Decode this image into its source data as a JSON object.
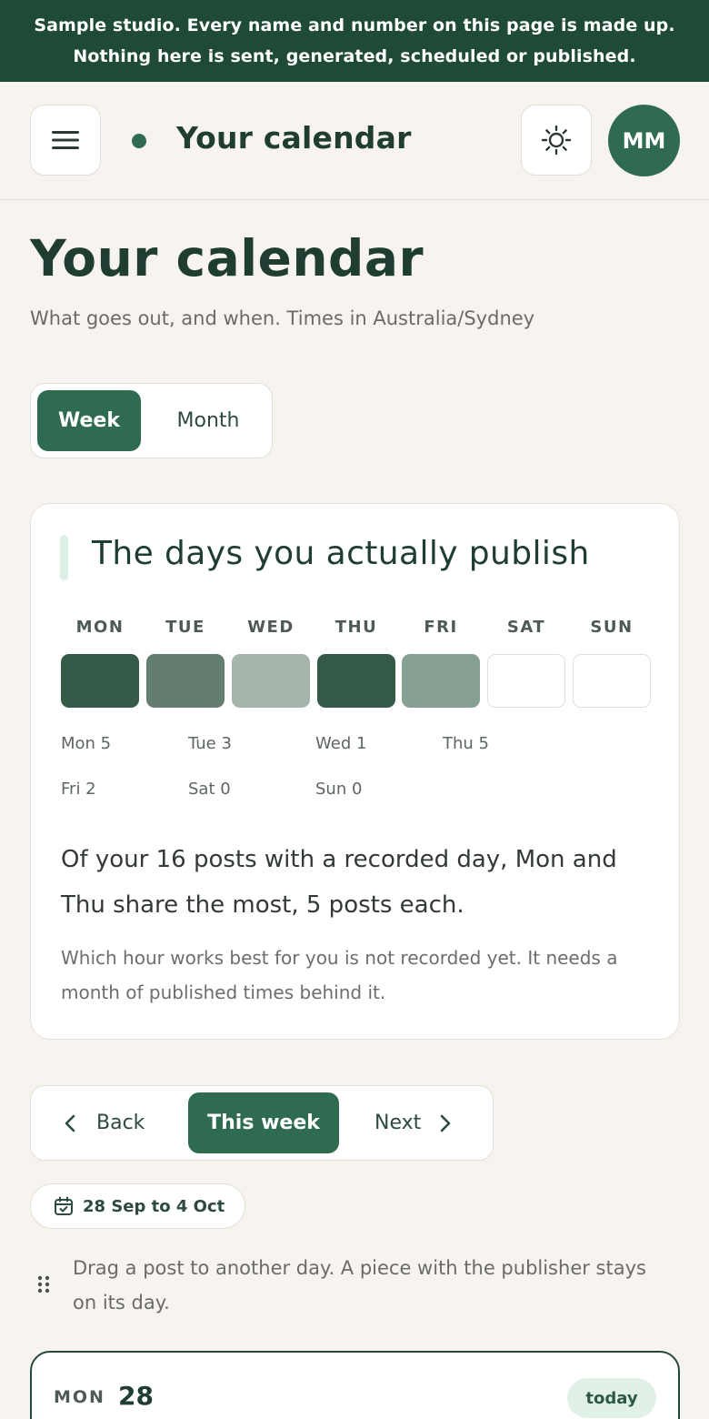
{
  "banner": {
    "line1": "Sample studio. Every name and number on this page is made up.",
    "line2": "Nothing here is sent, generated, scheduled or published."
  },
  "topbar": {
    "title": "Your calendar",
    "avatar_initials": "MM",
    "menu_icon": "hamburger-menu-icon",
    "theme_icon": "sun-icon"
  },
  "page": {
    "title": "Your calendar",
    "subtitle": "What goes out, and when. Times in Australia/Sydney"
  },
  "view_toggle": {
    "week": "Week",
    "month": "Month",
    "selected": "Week"
  },
  "publish_card": {
    "title": "The days you actually publish",
    "days": [
      {
        "label": "MON",
        "count_text": "Mon 5",
        "count": 5
      },
      {
        "label": "TUE",
        "count_text": "Tue 3",
        "count": 3
      },
      {
        "label": "WED",
        "count_text": "Wed 1",
        "count": 1
      },
      {
        "label": "THU",
        "count_text": "Thu 5",
        "count": 5
      },
      {
        "label": "FRI",
        "count_text": "Fri 2",
        "count": 2
      },
      {
        "label": "SAT",
        "count_text": "Sat 0",
        "count": 0
      },
      {
        "label": "SUN",
        "count_text": "Sun 0",
        "count": 0
      }
    ],
    "summary": "Of your 16 posts with a recorded day, Mon and Thu share the most, 5 posts each.",
    "note": "Which hour works best for you is not recorded yet. It needs a month of published times behind it."
  },
  "week_nav": {
    "back": "Back",
    "this_week": "This week",
    "next": "Next"
  },
  "range": {
    "label": "28 Sep to 4 Oct",
    "icon": "calendar-check-icon"
  },
  "drag_hint": {
    "text": "Drag a post to another day. A piece with the publisher stays on its day.",
    "icon": "drag-handle-icon"
  },
  "day_card": {
    "day": "MON",
    "date": "28",
    "badge": "today"
  },
  "colors": {
    "accent": "#2f6b50",
    "banner": "#1e4a36",
    "heat": [
      "#ffffff",
      "#a5b5ab",
      "#86a092",
      "#637e70",
      "#355a48"
    ]
  }
}
